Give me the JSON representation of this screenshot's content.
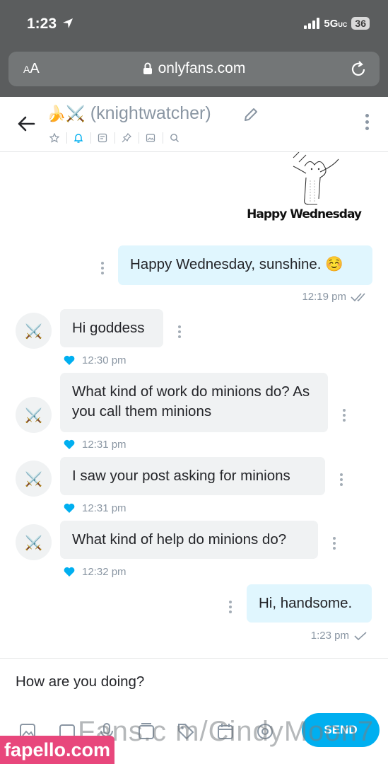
{
  "status_bar": {
    "time": "1:23",
    "network": "5G",
    "network_sub": "UC",
    "battery": "36"
  },
  "browser": {
    "text_size_label_small": "A",
    "text_size_label": "A",
    "url": "onlyfans.com"
  },
  "chat_header": {
    "emoji": "🍌⚔️",
    "title": "(knightwatcher)"
  },
  "sticker": {
    "caption": "Happy Wednesday"
  },
  "messages": [
    {
      "from": "me",
      "text": "Happy Wednesday, sunshine. ☺️",
      "time": "12:19 pm",
      "status": "read"
    },
    {
      "from": "them",
      "text": "Hi goddess",
      "time": "12:30 pm",
      "liked": true
    },
    {
      "from": "them",
      "text": "What kind of work do minions do? As you call them minions",
      "time": "12:31 pm",
      "liked": true
    },
    {
      "from": "them",
      "text": "I saw your post asking for minions",
      "time": "12:31 pm",
      "liked": true
    },
    {
      "from": "them",
      "text": "What kind of help do minions do?",
      "time": "12:32 pm",
      "liked": true
    },
    {
      "from": "me",
      "text": "Hi, handsome.",
      "time": "1:23 pm",
      "status": "sent"
    }
  ],
  "avatar_glyph": "⚔️",
  "composer": {
    "value": "How are you doing?",
    "send_label": "SEND"
  },
  "watermark": {
    "text": "Fans.c m/CindyMoon7",
    "badge": "fapello.com"
  },
  "colors": {
    "accent": "#00aff0",
    "muted": "#8a96a3",
    "incoming_bubble": "#f0f2f3",
    "outgoing_bubble": "#e0f6fe",
    "watermark_badge": "#e8477c"
  }
}
